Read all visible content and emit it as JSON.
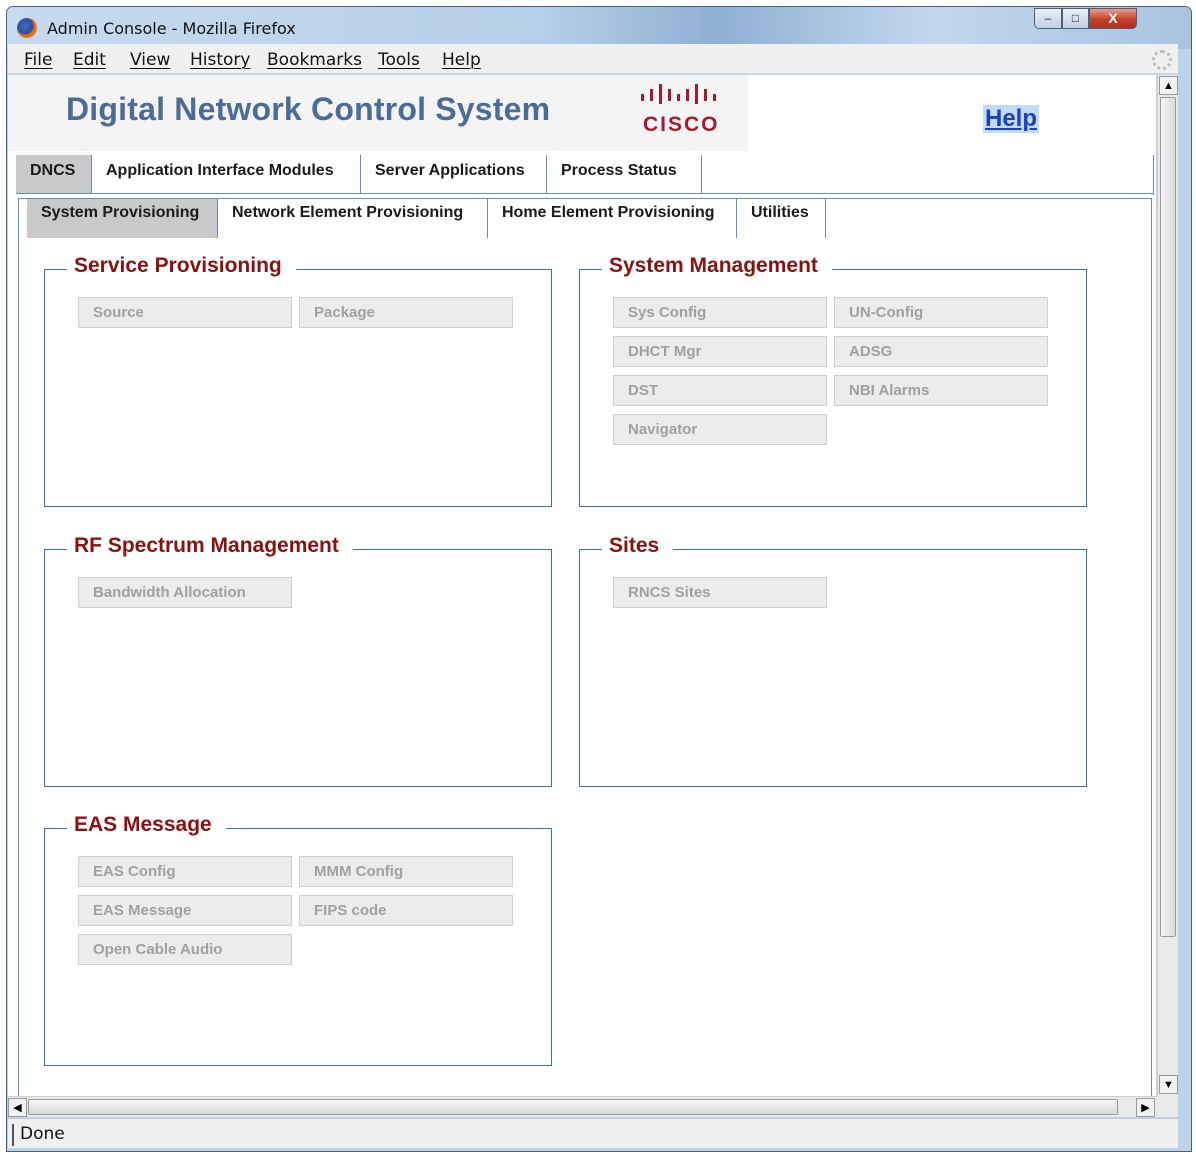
{
  "window": {
    "title": "Admin Console - Mozilla Firefox",
    "controls": {
      "minimize": "–",
      "maximize": "□",
      "close": "X"
    }
  },
  "menubar": [
    "File",
    "Edit",
    "View",
    "History",
    "Bookmarks",
    "Tools",
    "Help"
  ],
  "header": {
    "app_title": "Digital Network Control System",
    "logo_text": "CISCO",
    "help_link": "Help",
    "colors": {
      "title": "#4a6c96",
      "logo": "#a71930",
      "link": "#1b40c8"
    }
  },
  "main_tabs": [
    {
      "label": "DNCS",
      "active": true
    },
    {
      "label": "Application Interface Modules",
      "active": false
    },
    {
      "label": "Server Applications",
      "active": false
    },
    {
      "label": "Process Status",
      "active": false
    }
  ],
  "sub_tabs": [
    {
      "label": "System Provisioning",
      "active": true
    },
    {
      "label": "Network Element Provisioning",
      "active": false
    },
    {
      "label": "Home Element Provisioning",
      "active": false
    },
    {
      "label": "Utilities",
      "active": false
    }
  ],
  "groups": {
    "service_provisioning": {
      "title": "Service Provisioning",
      "buttons": [
        "Source",
        "Package"
      ]
    },
    "system_management": {
      "title": "System Management",
      "buttons": [
        "Sys Config",
        "UN-Config",
        "DHCT Mgr",
        "ADSG",
        "DST",
        "NBI Alarms",
        "Navigator"
      ]
    },
    "rf_spectrum": {
      "title": "RF Spectrum Management",
      "buttons": [
        "Bandwidth Allocation"
      ]
    },
    "sites": {
      "title": "Sites",
      "buttons": [
        "RNCS Sites"
      ]
    },
    "eas_message": {
      "title": "EAS Message",
      "buttons": [
        "EAS Config",
        "MMM Config",
        "EAS Message",
        "FIPS code",
        "Open Cable Audio"
      ]
    }
  },
  "status": {
    "text": "Done"
  },
  "scrollbars": {
    "up": "▲",
    "down": "▼",
    "left": "◀",
    "right": "▶"
  }
}
